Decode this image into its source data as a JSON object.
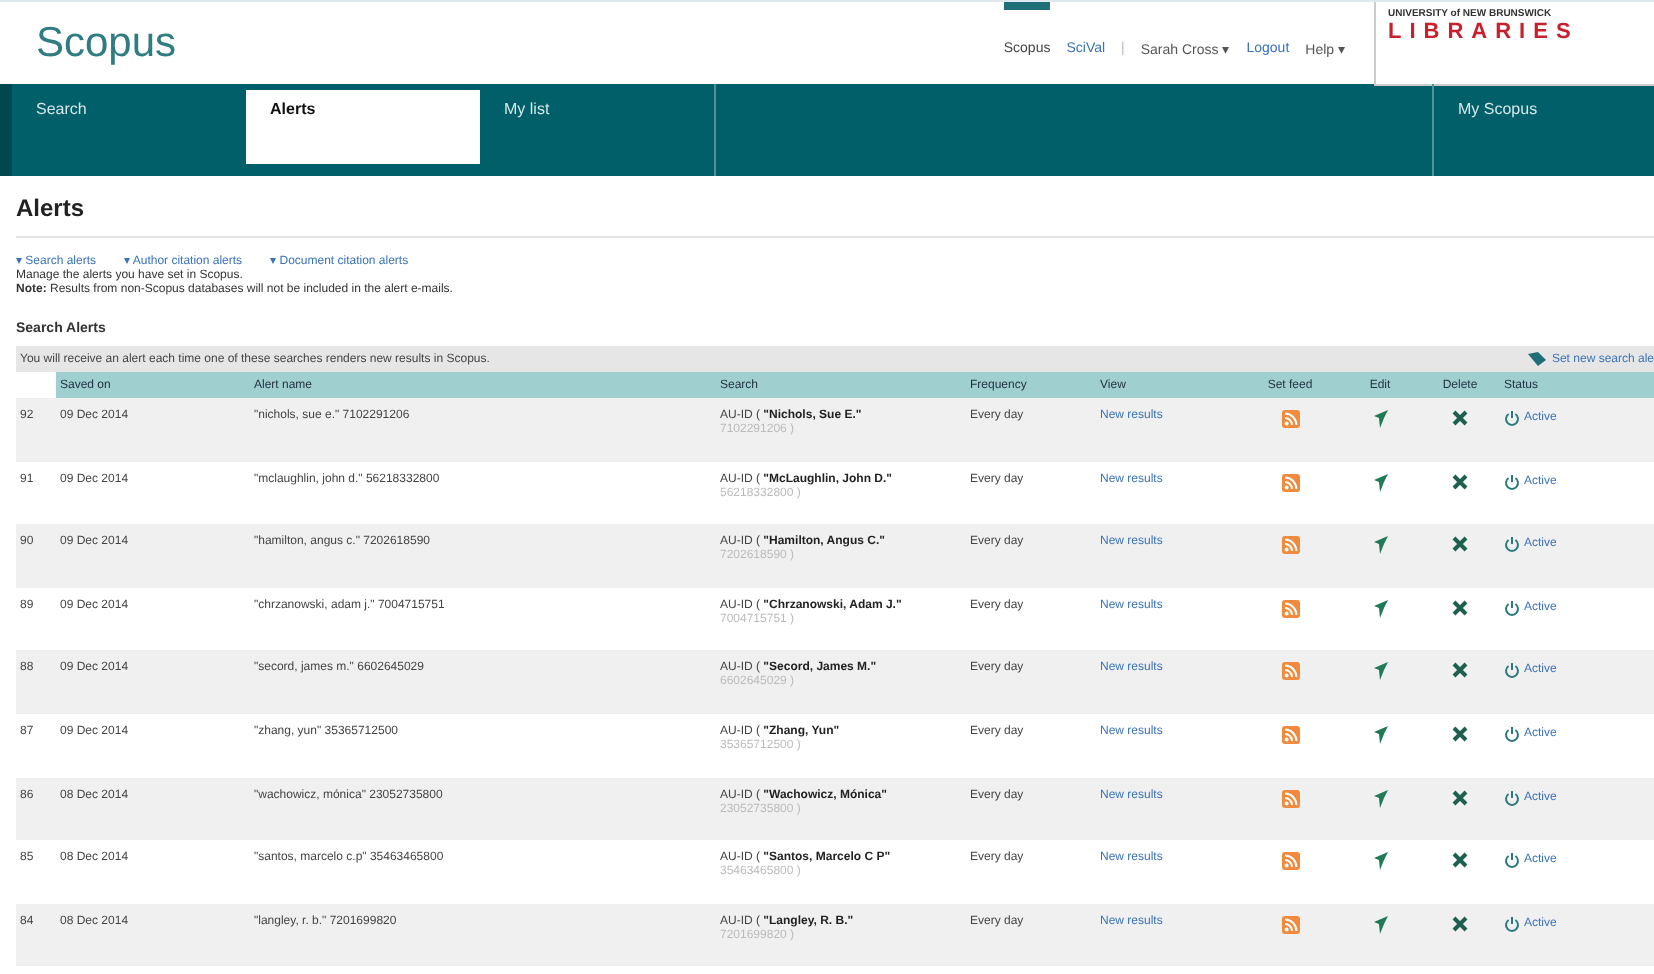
{
  "header": {
    "logo": "Scopus",
    "links": [
      {
        "label": "Scopus",
        "selected": true,
        "kind": "link"
      },
      {
        "label": "SciVal",
        "selected": false,
        "kind": "link"
      },
      {
        "label": "|",
        "selected": false,
        "kind": "sep"
      },
      {
        "label": "Sarah Cross ▾",
        "selected": false,
        "kind": "menu"
      },
      {
        "label": "Logout",
        "selected": false,
        "kind": "link"
      },
      {
        "label": "Help ▾",
        "selected": false,
        "kind": "menu"
      }
    ],
    "institution": {
      "line1": "UNIVERSITY of NEW BRUNSWICK",
      "line2": "LIBRARIES"
    }
  },
  "nav": {
    "tabs": [
      {
        "label": "Search",
        "selected": false
      },
      {
        "label": "Alerts",
        "selected": true
      },
      {
        "label": "My list",
        "selected": false
      }
    ],
    "right_tab": {
      "label": "My Scopus",
      "selected": false
    }
  },
  "page": {
    "title": "Alerts",
    "anchors": [
      "▾ Search alerts",
      "▾ Author citation alerts",
      "▾ Document citation alerts"
    ],
    "intro": "Manage the alerts you have set in Scopus.",
    "note": "**Note:** Results from non-Scopus databases will not be included in the alert e-mails."
  },
  "section": {
    "title": "Search Alerts",
    "info": "You will receive an alert each time one of these searches renders new results in Scopus.",
    "new_alert": "Set new search ale"
  },
  "table": {
    "columns": [
      "Saved on",
      "Alert name",
      "Search",
      "Frequency",
      "View",
      "Set feed",
      "Edit",
      "Delete",
      "Status"
    ],
    "rows": [
      {
        "number": "92",
        "saved_on": "09 Dec 2014",
        "alert_name": "\"nichols, sue e.\" 7102291206",
        "search_prefix": "AU-ID (",
        "search_name": "\"Nichols, Sue E.\"",
        "search_id": "7102291206 )",
        "frequency": "Every day",
        "view": "New results",
        "status": "Active"
      },
      {
        "number": "91",
        "saved_on": "09 Dec 2014",
        "alert_name": "\"mclaughlin, john d.\" 56218332800",
        "search_prefix": "AU-ID (",
        "search_name": "\"McLaughlin, John D.\"",
        "search_id": "56218332800 )",
        "frequency": "Every day",
        "view": "New results",
        "status": "Active"
      },
      {
        "number": "90",
        "saved_on": "09 Dec 2014",
        "alert_name": "\"hamilton, angus c.\" 7202618590",
        "search_prefix": "AU-ID (",
        "search_name": "\"Hamilton, Angus C.\"",
        "search_id": "7202618590 )",
        "frequency": "Every day",
        "view": "New results",
        "status": "Active"
      },
      {
        "number": "89",
        "saved_on": "09 Dec 2014",
        "alert_name": "\"chrzanowski, adam j.\" 7004715751",
        "search_prefix": "AU-ID (",
        "search_name": "\"Chrzanowski, Adam J.\"",
        "search_id": "7004715751 )",
        "frequency": "Every day",
        "view": "New results",
        "status": "Active"
      },
      {
        "number": "88",
        "saved_on": "09 Dec 2014",
        "alert_name": "\"secord, james m.\" 6602645029",
        "search_prefix": "AU-ID (",
        "search_name": "\"Secord, James M.\"",
        "search_id": "6602645029 )",
        "frequency": "Every day",
        "view": "New results",
        "status": "Active"
      },
      {
        "number": "87",
        "saved_on": "09 Dec 2014",
        "alert_name": "\"zhang, yun\" 35365712500",
        "search_prefix": "AU-ID (",
        "search_name": "\"Zhang, Yun\"",
        "search_id": "35365712500 )",
        "frequency": "Every day",
        "view": "New results",
        "status": "Active"
      },
      {
        "number": "86",
        "saved_on": "08 Dec 2014",
        "alert_name": "\"wachowicz, mónica\" 23052735800",
        "search_prefix": "AU-ID (",
        "search_name": "\"Wachowicz, Mónica\"",
        "search_id": "23052735800 )",
        "frequency": "Every day",
        "view": "New results",
        "status": "Active"
      },
      {
        "number": "85",
        "saved_on": "08 Dec 2014",
        "alert_name": "\"santos, marcelo c.p\" 35463465800",
        "search_prefix": "AU-ID (",
        "search_name": "\"Santos, Marcelo C P\"",
        "search_id": "35463465800 )",
        "frequency": "Every day",
        "view": "New results",
        "status": "Active"
      },
      {
        "number": "84",
        "saved_on": "08 Dec 2014",
        "alert_name": "\"langley, r. b.\" 7201699820",
        "search_prefix": "AU-ID (",
        "search_name": "\"Langley, R. B.\"",
        "search_id": "7201699820 )",
        "frequency": "Every day",
        "view": "New results",
        "status": "Active"
      }
    ]
  }
}
